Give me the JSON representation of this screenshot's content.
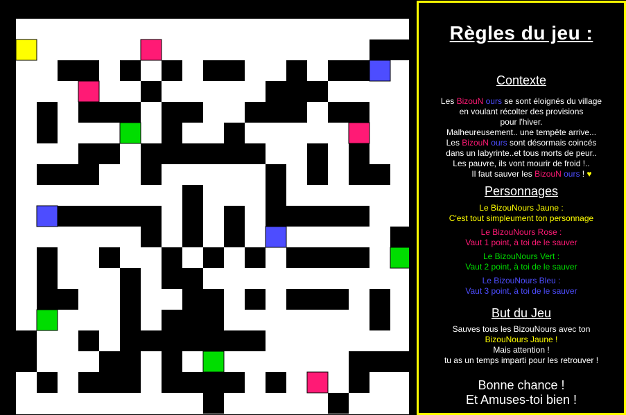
{
  "colors": {
    "wall": "#000000",
    "path": "#ffffff",
    "yellow": "#ffff00",
    "pink": "#ff1a75",
    "green": "#00dd00",
    "blue": "#4d4dff"
  },
  "maze": {
    "rows": [
      "...................",
      "Y.....P..........WW",
      "..WW.W.W.WW..W.WWB.",
      "...P..W.....WWW....",
      ".W.WWW.WW..WWW.WW..",
      ".W...G.W..W.....P..",
      "...WW.WWWWWW..W.W..",
      ".WWW..W.....W.W.WW.",
      "........W...W......",
      ".BWWWWW.W.W.WWWWW..",
      "......W.W.W.B.....W",
      ".W..W..W.W.W.WWWW.G",
      ".W...W.WW..........",
      ".WW..W..WW.W.WWW.W.",
      ".G...W.WWW.......W.",
      "W..W.WWWWWWW.......",
      "W...WW.W.G......WWW",
      ".W.WWW.WWWW.W.P.W..",
      ".........W.....W...",
      "..................."
    ]
  },
  "rules": {
    "title": "Règles du jeu :",
    "context_title": "Contexte",
    "context_lines": [
      [
        "Les ",
        "Biz",
        "ouN",
        " ours",
        "  se sont éloignés du village"
      ],
      [
        "en voulant récolter des provisions"
      ],
      [
        "pour l'hiver."
      ],
      [
        "Malheureusement.. une tempête arrive..."
      ],
      [
        "Les ",
        "Biz",
        "ouN",
        " ours",
        "  sont désormais coincés"
      ],
      [
        "dans un labyrinte..et tous morts de peur.."
      ],
      [
        "Les pauvre, ils vont mourir de froid !.."
      ],
      [
        "Il faut sauver les ",
        "Biz",
        "ouN",
        " ours",
        "  ! ",
        "♥"
      ]
    ],
    "characters_title": "Personnages",
    "characters": [
      {
        "name": "Le BizouNours Jaune :",
        "desc": "C'est tout simpleument ton personnage",
        "color": "yellow"
      },
      {
        "name": "Le BizouNours Rose :",
        "desc": "Vaut 1 point, à toi de le sauver",
        "color": "rose"
      },
      {
        "name": "Le BizouNours Vert :",
        "desc": "Vaut 2 point, à toi de le sauver",
        "color": "green"
      },
      {
        "name": "Le BizouNours Bleu :",
        "desc": "Vaut 3 point, à toi de le sauver",
        "color": "bleu"
      }
    ],
    "goal_title": "But du Jeu",
    "goal_lines": [
      "Sauves tous les BizouNours avec ton",
      "BizouNours Jaune !",
      "Mais attention !",
      "tu as un temps imparti pour les retrouver !"
    ],
    "farewell_lines": [
      "Bonne chance !",
      "Et Amuses-toi bien !"
    ]
  }
}
